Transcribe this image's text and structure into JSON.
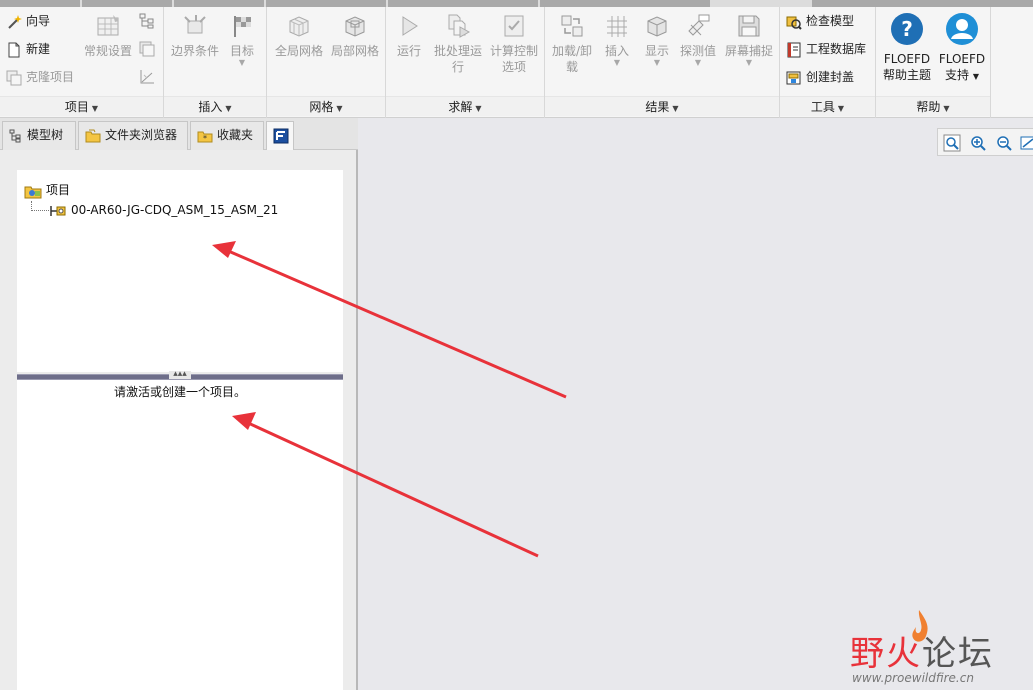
{
  "ribbon": {
    "project": {
      "label": "项目",
      "wizard": "向导",
      "new": "新建",
      "clone": "克隆项目",
      "general_settings": "常规设置"
    },
    "insert": {
      "label": "插入",
      "boundary": "边界条件",
      "goals": "目标"
    },
    "mesh": {
      "label": "网格",
      "global": "全局网格",
      "local": "局部网格"
    },
    "solve": {
      "label": "求解",
      "run": "运行",
      "batch_line1": "批处理运",
      "batch_line2": "行",
      "calc_line1": "计算控制",
      "calc_line2": "选项"
    },
    "results": {
      "label": "结果",
      "load_line1": "加载/卸",
      "load_line2": "载",
      "insert": "插入",
      "display": "显示",
      "probe": "探测值",
      "screen_capture": "屏幕捕捉"
    },
    "tools": {
      "label": "工具",
      "check_model": "检查模型",
      "eng_database": "工程数据库",
      "create_lids": "创建封盖"
    },
    "help": {
      "label": "帮助",
      "help_line1": "FLOEFD",
      "help_line2": "帮助主题",
      "support_line1": "FLOEFD",
      "support_line2": "支持"
    }
  },
  "panel": {
    "tabs": [
      "模型树",
      "文件夹浏览器",
      "收藏夹"
    ],
    "tree_root": "项目",
    "tree_child": "00-AR60-JG-CDQ_ASM_15_ASM_21",
    "message": "请激活或创建一个项目。"
  },
  "watermark": {
    "title_red": "野火",
    "title_gray": "论坛",
    "url": "www.proewildfire.cn"
  },
  "colors": {
    "annotation_arrow": "#e8323a",
    "ribbon_bg": "#f5f5f5",
    "workspace_bg": "#e8e8ec"
  }
}
